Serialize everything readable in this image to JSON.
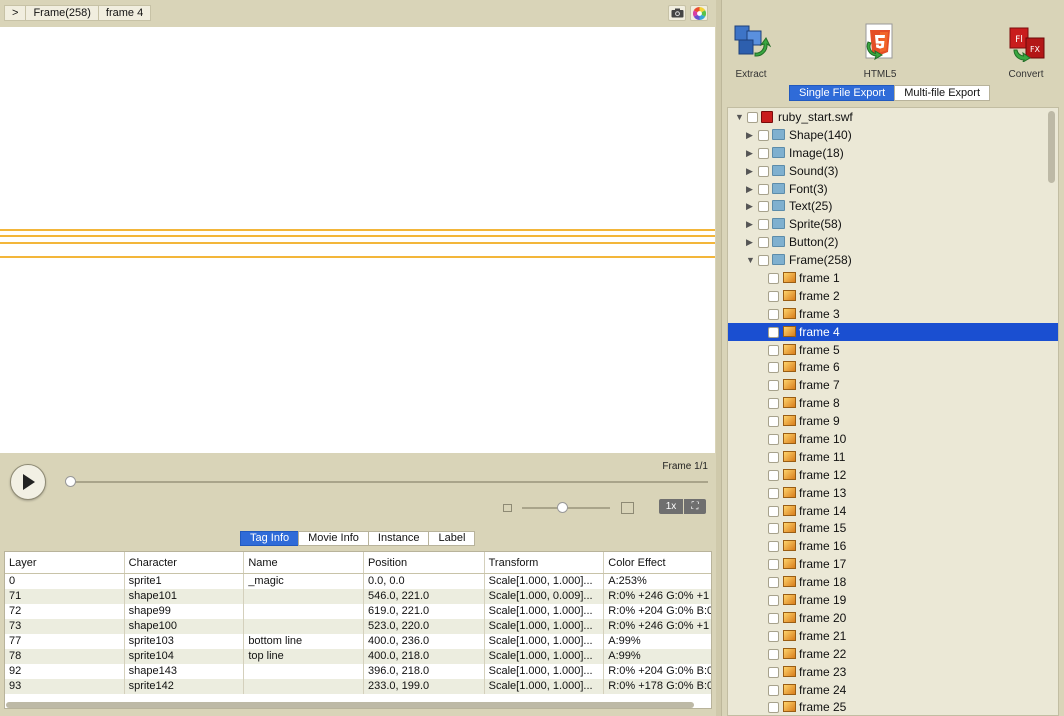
{
  "breadcrumb": {
    "back": ">",
    "items": [
      "Frame(258)",
      "frame 4"
    ]
  },
  "icons": {
    "camera": "camera-icon",
    "color": "color-wheel-icon"
  },
  "player": {
    "frame_label": "Frame 1/1",
    "progress": 0,
    "zoom_level": 0.45,
    "scale_label": "1x",
    "fit_label": "⛶"
  },
  "info_tabs": {
    "items": [
      "Tag Info",
      "Movie Info",
      "Instance",
      "Label"
    ],
    "active": 0
  },
  "table": {
    "headers": [
      "Layer",
      "Character",
      "Name",
      "Position",
      "Transform",
      "Color Effect"
    ],
    "rows": [
      [
        "0",
        "sprite1",
        "_magic",
        "0.0, 0.0",
        "Scale[1.000, 1.000]...",
        "A:253%"
      ],
      [
        "71",
        "shape101",
        "",
        "546.0, 221.0",
        "Scale[1.000, 0.009]...",
        "R:0% +246 G:0% +1"
      ],
      [
        "72",
        "shape99",
        "",
        "619.0, 221.0",
        "Scale[1.000, 1.000]...",
        "R:0% +204 G:0% B:0"
      ],
      [
        "73",
        "shape100",
        "",
        "523.0, 220.0",
        "Scale[1.000, 1.000]...",
        "R:0% +246 G:0% +1"
      ],
      [
        "77",
        "sprite103",
        "bottom line",
        "400.0, 236.0",
        "Scale[1.000, 1.000]...",
        "A:99%"
      ],
      [
        "78",
        "sprite104",
        "top line",
        "400.0, 218.0",
        "Scale[1.000, 1.000]...",
        "A:99%"
      ],
      [
        "92",
        "shape143",
        "",
        "396.0, 218.0",
        "Scale[1.000, 1.000]...",
        "R:0% +204 G:0% B:0"
      ],
      [
        "93",
        "sprite142",
        "",
        "233.0, 199.0",
        "Scale[1.000, 1.000]...",
        "R:0% +178 G:0% B:0"
      ]
    ]
  },
  "tools": {
    "extract": "Extract",
    "html5": "HTML5",
    "convert": "Convert"
  },
  "export_tabs": {
    "items": [
      "Single File Export",
      "Multi-file Export"
    ],
    "active": 0
  },
  "tree": {
    "root": "ruby_start.swf",
    "groups": [
      "Shape(140)",
      "Image(18)",
      "Sound(3)",
      "Font(3)",
      "Text(25)",
      "Sprite(58)",
      "Button(2)",
      "Frame(258)"
    ],
    "frames": [
      "frame 1",
      "frame 2",
      "frame 3",
      "frame 4",
      "frame 5",
      "frame 6",
      "frame 7",
      "frame 8",
      "frame 9",
      "frame 10",
      "frame 11",
      "frame 12",
      "frame 13",
      "frame 14",
      "frame 15",
      "frame 16",
      "frame 17",
      "frame 18",
      "frame 19",
      "frame 20",
      "frame 21",
      "frame 22",
      "frame 23",
      "frame 24",
      "frame 25"
    ],
    "selected_frame": 3
  },
  "colors": {
    "accent": "#2f6bd8",
    "selection": "#1a4fd1",
    "stage_line": "#f3b63a",
    "panel_bg": "#d9d4b8"
  }
}
